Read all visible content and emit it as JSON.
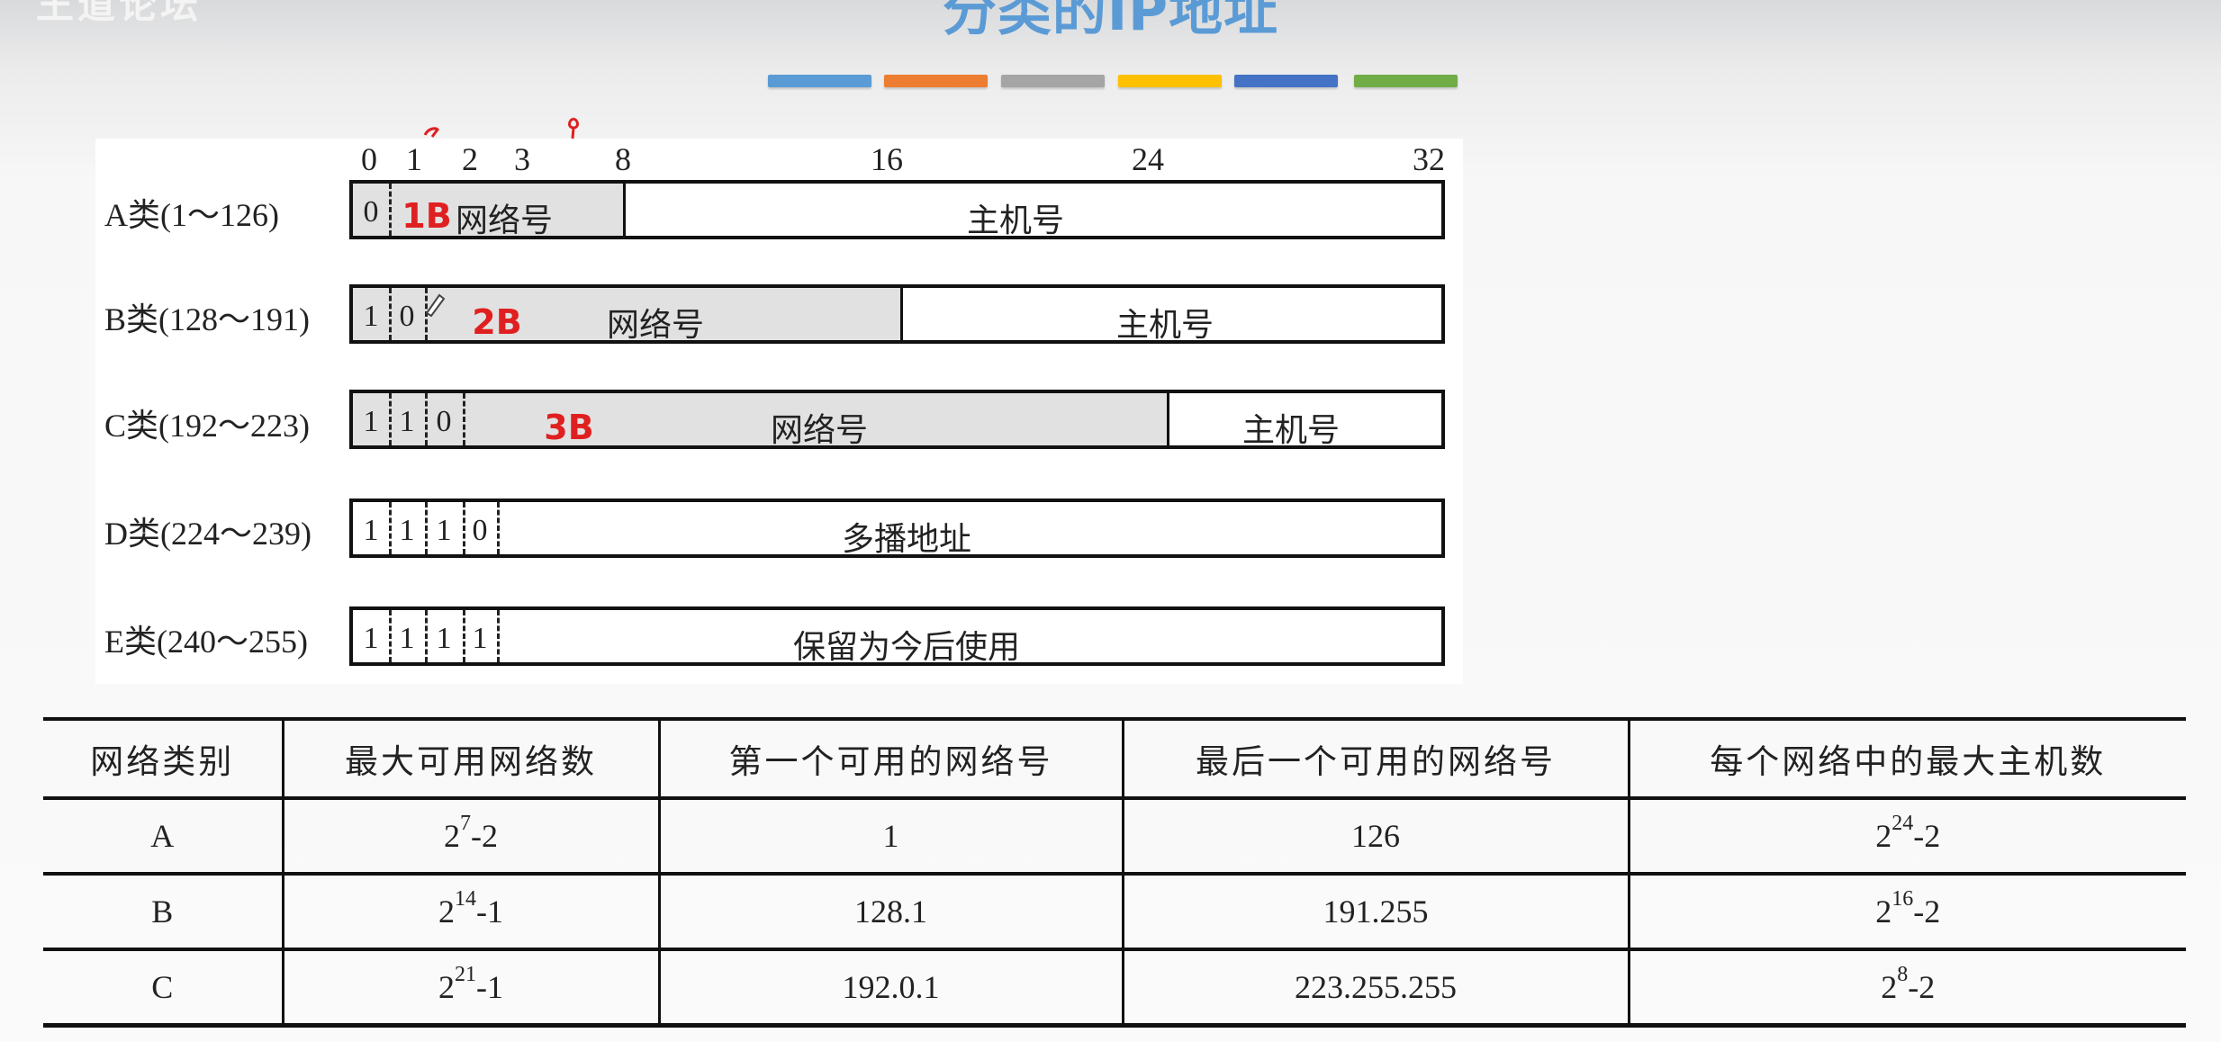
{
  "watermark": "王道论坛",
  "title": "分类的IP地址",
  "title_bar_colors": [
    "#5b9bd5",
    "#ed7d31",
    "#a5a5a5",
    "#ffc000",
    "#4472c4",
    "#70ad47"
  ],
  "diagram": {
    "ticks": [
      "0",
      "1",
      "2",
      "3",
      "8",
      "16",
      "24",
      "32"
    ],
    "rows": [
      {
        "label": "A类(1～126)",
        "bits": [
          "0"
        ],
        "annotation": "1B",
        "network_label": "网络号",
        "host_label": "主机号"
      },
      {
        "label": "B类(128～191)",
        "bits": [
          "1",
          "0"
        ],
        "annotation": "2B",
        "network_label": "网络号",
        "host_label": "主机号"
      },
      {
        "label": "C类(192～223)",
        "bits": [
          "1",
          "1",
          "0"
        ],
        "annotation": "3B",
        "network_label": "网络号",
        "host_label": "主机号"
      },
      {
        "label": "D类(224～239)",
        "bits": [
          "1",
          "1",
          "1",
          "0"
        ],
        "rest_label": "多播地址"
      },
      {
        "label": "E类(240～255)",
        "bits": [
          "1",
          "1",
          "1",
          "1"
        ],
        "rest_label": "保留为今后使用"
      }
    ]
  },
  "table": {
    "headers": [
      "网络类别",
      "最大可用网络数",
      "第一个可用的网络号",
      "最后一个可用的网络号",
      "每个网络中的最大主机数"
    ],
    "rows": [
      {
        "class": "A",
        "max_networks": {
          "base": "2",
          "exp": "7",
          "suffix": "-2"
        },
        "first": "1",
        "last": "126",
        "max_hosts": {
          "base": "2",
          "exp": "24",
          "suffix": "-2"
        }
      },
      {
        "class": "B",
        "max_networks": {
          "base": "2",
          "exp": "14",
          "suffix": "-1"
        },
        "first": "128.1",
        "last": "191.255",
        "max_hosts": {
          "base": "2",
          "exp": "16",
          "suffix": "-2"
        }
      },
      {
        "class": "C",
        "max_networks": {
          "base": "2",
          "exp": "21",
          "suffix": "-1"
        },
        "first": "192.0.1",
        "last": "223.255.255",
        "max_hosts": {
          "base": "2",
          "exp": "8",
          "suffix": "-2"
        }
      }
    ]
  }
}
